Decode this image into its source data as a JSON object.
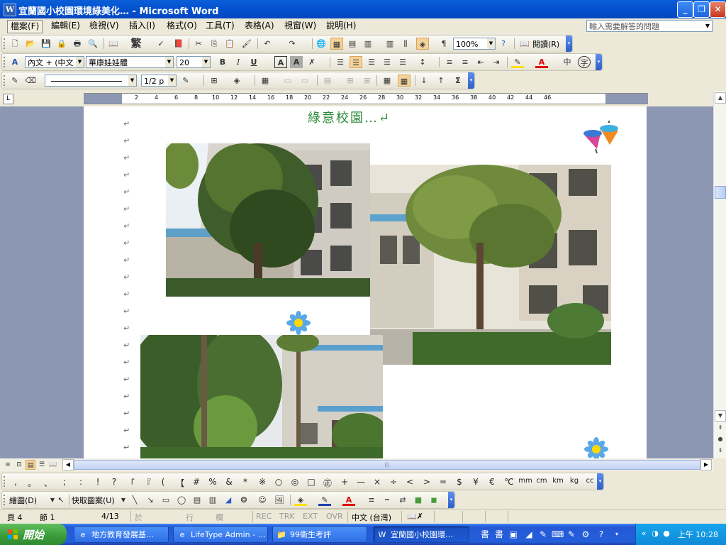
{
  "window": {
    "title": "宜蘭國小校園環境綠美化… - Microsoft Word",
    "app_icon": "W",
    "buttons": {
      "minimize": "_",
      "restore": "❐",
      "close": "✕"
    }
  },
  "menu": [
    {
      "label": "檔案(F)",
      "active": true
    },
    {
      "label": "編輯(E)"
    },
    {
      "label": "檢視(V)"
    },
    {
      "label": "插入(I)"
    },
    {
      "label": "格式(O)"
    },
    {
      "label": "工具(T)"
    },
    {
      "label": "表格(A)"
    },
    {
      "label": "視窗(W)"
    },
    {
      "label": "說明(H)"
    }
  ],
  "help_search": {
    "placeholder": "輸入需要解答的問題"
  },
  "standard_toolbar": {
    "traditional_label": "繁",
    "zoom": "100%",
    "reading_label": "閱讀(R)"
  },
  "format_toolbar": {
    "style": "內文 + (中文",
    "font": "華康娃娃體",
    "size": "20",
    "bold": "B",
    "italic": "I",
    "underline": "U",
    "char_border": "A",
    "char_shading": "A",
    "phonetic": "中",
    "enclose": "字"
  },
  "table_toolbar": {
    "line_weight": "1/2 p"
  },
  "ruler": {
    "numbers": [
      "2",
      "4",
      "6",
      "8",
      "10",
      "12",
      "14",
      "16",
      "18",
      "20",
      "22",
      "24",
      "26",
      "28",
      "30",
      "32",
      "34",
      "36",
      "38",
      "40",
      "42",
      "44",
      "46"
    ]
  },
  "document": {
    "heading": "綠意校園…↵",
    "para_mark": "↵"
  },
  "view_buttons": [
    "normal-view",
    "web-view",
    "print-view",
    "outline-view",
    "reading-view"
  ],
  "symbols": [
    ",",
    "。",
    "、",
    ";",
    ":",
    "!",
    "?",
    "「",
    "『",
    "(",
    "【",
    "#",
    "%",
    "&",
    "*",
    "※",
    "○",
    "◎",
    "□",
    "㊣",
    "+",
    "—",
    "×",
    "÷",
    "<",
    ">",
    "=",
    "$",
    "¥",
    "€",
    "℃",
    "mm",
    "cm",
    "km",
    "kg",
    "cc"
  ],
  "drawing_toolbar": {
    "draw_label": "繪圖(D)",
    "autoshapes_label": "快取圖案(U)"
  },
  "status": {
    "page": "頁 4",
    "section": "節 1",
    "page_of": "4/13",
    "at": "於",
    "line": "行",
    "column": "欄",
    "rec": "REC",
    "trk": "TRK",
    "ext": "EXT",
    "ovr": "OVR",
    "language": "中文 (台灣)"
  },
  "taskbar": {
    "start_label": "開始",
    "tasks": [
      {
        "label": "地方教育發展基…",
        "icon": "ie-icon"
      },
      {
        "label": "LifeType Admin - …",
        "icon": "ie-icon"
      },
      {
        "label": "99衛生考評",
        "icon": "folder-icon"
      },
      {
        "label": "宜蘭國小校園環…",
        "icon": "word-icon",
        "active": true
      }
    ],
    "quick_launch": [
      "書",
      "書"
    ],
    "clock": "上午 10:28"
  },
  "colors": {
    "title_bar": "#0553d0",
    "heading_green": "#2d8a3a",
    "page_bg": "#8c97b4",
    "taskbar": "#245edb",
    "start_green": "#3a9a3a"
  }
}
